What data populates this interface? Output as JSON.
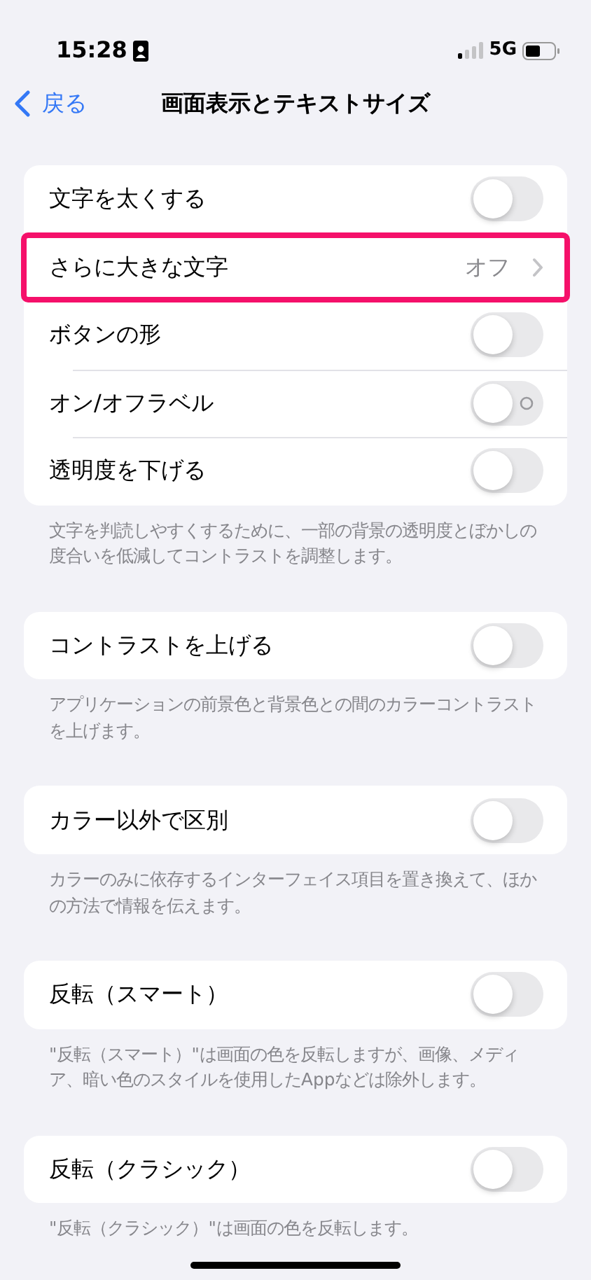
{
  "status_bar": {
    "time": "15:28",
    "network": "5G"
  },
  "nav": {
    "back": "戻る",
    "title": "画面表示とテキストサイズ"
  },
  "groups": [
    {
      "rows": [
        {
          "kind": "toggle",
          "label": "文字を太くする",
          "on": false,
          "highlighted": false
        },
        {
          "kind": "disclosure",
          "label": "さらに大きな文字",
          "value": "オフ",
          "highlighted": true
        },
        {
          "kind": "toggle",
          "label": "ボタンの形",
          "on": false,
          "highlighted": false
        },
        {
          "kind": "toggle",
          "label": "オン/オフラベル",
          "on": false,
          "off_label": true,
          "highlighted": false
        },
        {
          "kind": "toggle",
          "label": "透明度を下げる",
          "on": false,
          "highlighted": false
        }
      ],
      "footer": "文字を判読しやすくするために、一部の背景の透明度とぼかしの度合いを低減してコントラストを調整します。"
    },
    {
      "rows": [
        {
          "kind": "toggle",
          "label": "コントラストを上げる",
          "on": false,
          "highlighted": false
        }
      ],
      "footer": "アプリケーションの前景色と背景色との間のカラーコントラストを上げます。"
    },
    {
      "rows": [
        {
          "kind": "toggle",
          "label": "カラー以外で区別",
          "on": false,
          "highlighted": false
        }
      ],
      "footer": "カラーのみに依存するインターフェイス項目を置き換えて、ほかの方法で情報を伝えます。"
    },
    {
      "rows": [
        {
          "kind": "toggle",
          "label": "反転（スマート）",
          "on": false,
          "highlighted": false
        }
      ],
      "footer": "\"反転（スマート）\"は画面の色を反転しますが、画像、メディア、暗い色のスタイルを使用したAppなどは除外します。"
    },
    {
      "rows": [
        {
          "kind": "toggle",
          "label": "反転（クラシック）",
          "on": false,
          "highlighted": false
        }
      ],
      "footer": "\"反転（クラシック）\"は画面の色を反転します。"
    }
  ]
}
